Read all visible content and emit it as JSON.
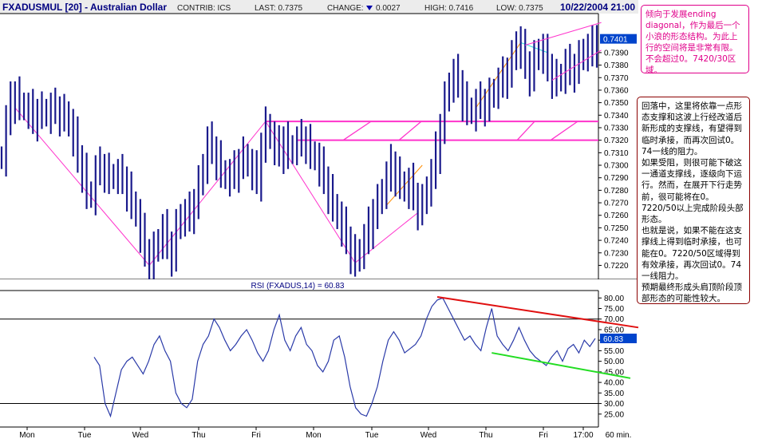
{
  "header": {
    "symbol": "FXADUSMUL [20] - Australian Dollar",
    "contrib": "CONTRIB: ICS",
    "last": "LAST: 0.7375",
    "change_label": "CHANGE:",
    "change_value": "0.0027",
    "high": "HIGH: 0.7416",
    "low": "LOW: 0.7375",
    "datetime": "10/22/2004 21:00"
  },
  "annotations": {
    "note_top": "倾向于发展ending diagonal，作为最后一个小浪的形态结构。为此上行的空间将是非常有限。不会超过0。7420/30区域。",
    "note_main": [
      "回落中，这里将依靠一点形态支撑和这波上行经改道后新形成的支撑线，有望得到临时承接，而再次回试0。74一线的阻力。",
      "如果受阻，则很可能下破这一通道支撑线，逐级向下运行。然而，在展开下行走势前，很可能将在0。7220/50以上完成阶段头部形态。",
      "也就是说，如果不能在这支撑线上得到临时承接，也可能在0。7220/50区域得到有效承接，再次回试0。74一线阻力。",
      "预期最终形成头肩顶阶段顶部形态的可能性较大。"
    ]
  },
  "colors": {
    "price": "#1a1a8c",
    "zigzag": "#ff33cc",
    "support": "#ff33cc",
    "rsi_line": "#2a3aa8",
    "rsi_resistance": "#e01010",
    "rsi_support": "#22dd22",
    "grid": "#000000",
    "last_box": "#0044cc",
    "down_arrow": "#0000aa",
    "orange_wave": "#ff8c00",
    "cyan_wave": "#33dddd"
  },
  "chart_data": [
    {
      "type": "line",
      "panel": "price",
      "title": "FXADUSMUL [20] - Australian Dollar",
      "bar_interval": "60 min.",
      "x_ticks": [
        "Mon",
        "Tue",
        "Wed",
        "Thu",
        "Fri",
        "Mon",
        "Tue",
        "Wed",
        "Thu",
        "Fri",
        "17:00",
        "60 min."
      ],
      "y_ticks": [
        "0.7220",
        "0.7230",
        "0.7240",
        "0.7250",
        "0.7260",
        "0.7270",
        "0.7280",
        "0.7290",
        "0.7300",
        "0.7310",
        "0.7320",
        "0.7330",
        "0.7340",
        "0.7350",
        "0.7360",
        "0.7370",
        "0.7380",
        "0.7390"
      ],
      "ylim": [
        0.7212,
        0.7418
      ],
      "last_value": "0.7401",
      "series": [
        {
          "values": [
            0.7306,
            0.7335,
            0.735,
            0.7356,
            0.7349,
            0.7345,
            0.7344,
            0.7336,
            0.7342,
            0.7344,
            0.734,
            0.7345,
            0.7344,
            0.734,
            0.7342,
            0.7332,
            0.7322,
            0.7305,
            0.7295,
            0.7278,
            0.7275,
            0.7295,
            0.7298,
            0.7295,
            0.729,
            0.7292,
            0.7292,
            0.7288,
            0.728,
            0.727,
            0.726,
            0.7245,
            0.723,
            0.7222,
            0.7232,
            0.724,
            0.7248,
            0.7236,
            0.7228,
            0.725,
            0.726,
            0.7258,
            0.7262,
            0.727,
            0.7285,
            0.73,
            0.7318,
            0.7312,
            0.7305,
            0.7295,
            0.729,
            0.7292,
            0.7295,
            0.7302,
            0.7308,
            0.73,
            0.7295,
            0.7288,
            0.7315,
            0.7332,
            0.7322,
            0.7315,
            0.731,
            0.732,
            0.731,
            0.7315,
            0.7318,
            0.732,
            0.7318,
            0.731,
            0.7305,
            0.7298,
            0.7288,
            0.7278,
            0.7268,
            0.7258,
            0.725,
            0.724,
            0.723,
            0.7224,
            0.7232,
            0.724,
            0.725,
            0.7262,
            0.727,
            0.728,
            0.729,
            0.73,
            0.7292,
            0.7286,
            0.728,
            0.7285,
            0.7275,
            0.7265,
            0.727,
            0.7282,
            0.7292,
            0.731,
            0.733,
            0.7352,
            0.7365,
            0.7372,
            0.7365,
            0.7352,
            0.7345,
            0.7342,
            0.7348,
            0.735,
            0.7348,
            0.7355,
            0.736,
            0.7365,
            0.737,
            0.7375,
            0.7385,
            0.7398,
            0.7392,
            0.738,
            0.7372,
            0.7385,
            0.7392,
            0.7388,
            0.7378,
            0.737,
            0.7368,
            0.7372,
            0.738,
            0.7375,
            0.7378,
            0.7385,
            0.7392,
            0.739,
            0.7395,
            0.7401
          ]
        }
      ],
      "support_levels": [
        0.7335,
        0.732
      ],
      "annotations": [
        "ending diagonal",
        "zigzag swing lines"
      ]
    },
    {
      "type": "line",
      "panel": "rsi",
      "title": "RSI (FXADUS,14) = 60.83",
      "y_ticks": [
        "25.00",
        "30.00",
        "35.00",
        "40.00",
        "45.00",
        "50.00",
        "55.00",
        "60.00",
        "65.00",
        "70.00",
        "75.00",
        "80.00"
      ],
      "ylim": [
        20,
        82
      ],
      "reference_lines": [
        70,
        30
      ],
      "last_value": "60.83",
      "series": [
        {
          "values": [
            52,
            48,
            30,
            24,
            35,
            46,
            50,
            52,
            48,
            44,
            50,
            58,
            62,
            55,
            50,
            35,
            30,
            28,
            32,
            50,
            58,
            62,
            70,
            66,
            60,
            55,
            58,
            62,
            65,
            60,
            54,
            50,
            55,
            65,
            72,
            60,
            55,
            62,
            66,
            58,
            55,
            48,
            45,
            50,
            60,
            62,
            52,
            38,
            28,
            25,
            24,
            30,
            38,
            50,
            60,
            64,
            60,
            54,
            56,
            58,
            62,
            70,
            76,
            79,
            80,
            75,
            70,
            65,
            60,
            62,
            58,
            55,
            66,
            75,
            62,
            58,
            55,
            60,
            66,
            60,
            55,
            52,
            50,
            48,
            52,
            55,
            50,
            56,
            58,
            54,
            60,
            57,
            60.83
          ]
        }
      ],
      "trendlines": [
        "resistance",
        "support"
      ]
    }
  ]
}
